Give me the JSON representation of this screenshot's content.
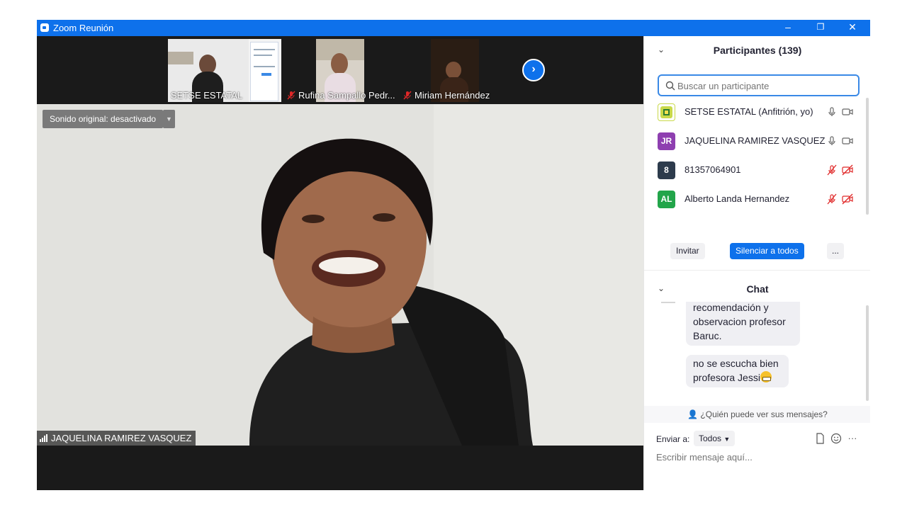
{
  "window": {
    "title": "Zoom Reunión",
    "minimize": "–",
    "restore": "❐",
    "close": "✕"
  },
  "thumbnails": [
    {
      "name": "SETSE ESTATAL",
      "muted": false
    },
    {
      "name": "Rufina Sampallo Pedr...",
      "muted": true
    },
    {
      "name": "Miriam Hernández",
      "muted": true
    }
  ],
  "next_icon": "chevron-right-icon",
  "main": {
    "sound_button": "Sonido original: desactivado",
    "speaker_name": "JAQUELINA RAMIREZ VASQUEZ"
  },
  "participants": {
    "title": "Participantes (139)",
    "search_placeholder": "Buscar un participante",
    "list": [
      {
        "initials": "",
        "name": "SETSE ESTATAL (Anfitrión, yo)",
        "color": "#c9d94a",
        "mic_muted": false,
        "cam_off": false
      },
      {
        "initials": "JR",
        "name": "JAQUELINA RAMIREZ VASQUEZ",
        "color": "#8e3fb0",
        "mic_muted": false,
        "cam_off": false
      },
      {
        "initials": "8",
        "name": "81357064901",
        "color": "#2d3b4c",
        "mic_muted": true,
        "cam_off": true
      },
      {
        "initials": "AL",
        "name": "Alberto Landa Hernandez",
        "color": "#22a54a",
        "mic_muted": true,
        "cam_off": true
      }
    ],
    "invite": "Invitar",
    "mute_all": "Silenciar a todos",
    "more": "..."
  },
  "chat": {
    "title": "Chat",
    "messages": [
      {
        "text": "recomendación y observacion profesor Baruc."
      },
      {
        "text": "no se escucha bien profesora Jessi"
      }
    ],
    "who_can_see": "¿Quién puede ver sus mensajes?",
    "send_to_label": "Enviar a:",
    "send_to_value": "Todos",
    "input_placeholder": "Escribir mensaje aquí..."
  }
}
